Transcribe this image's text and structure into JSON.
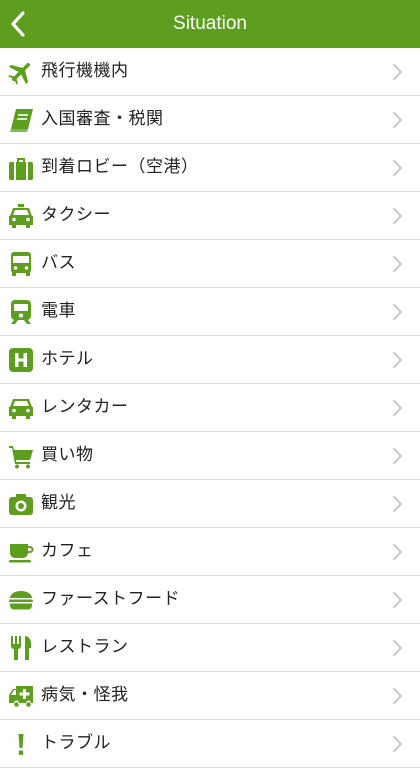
{
  "header": {
    "title": "Situation",
    "back_icon": "chevron-left-icon"
  },
  "colors": {
    "accent": "#5d9e1f",
    "separator": "#dcdcdc",
    "chevron": "#c7c7cc"
  },
  "situations": [
    {
      "label": "飛行機機内",
      "icon": "airplane-icon"
    },
    {
      "label": "入国審査・税関",
      "icon": "passport-book-icon"
    },
    {
      "label": "到着ロビー（空港）",
      "icon": "suitcase-icon"
    },
    {
      "label": "タクシー",
      "icon": "taxi-icon"
    },
    {
      "label": "バス",
      "icon": "bus-icon"
    },
    {
      "label": "電車",
      "icon": "train-icon"
    },
    {
      "label": "ホテル",
      "icon": "hotel-icon"
    },
    {
      "label": "レンタカー",
      "icon": "car-icon"
    },
    {
      "label": "買い物",
      "icon": "shopping-cart-icon"
    },
    {
      "label": "観光",
      "icon": "camera-icon"
    },
    {
      "label": "カフェ",
      "icon": "coffee-cup-icon"
    },
    {
      "label": "ファーストフード",
      "icon": "burger-icon"
    },
    {
      "label": "レストラン",
      "icon": "fork-knife-icon"
    },
    {
      "label": "病気・怪我",
      "icon": "ambulance-icon"
    },
    {
      "label": "トラブル",
      "icon": "exclamation-icon"
    }
  ]
}
